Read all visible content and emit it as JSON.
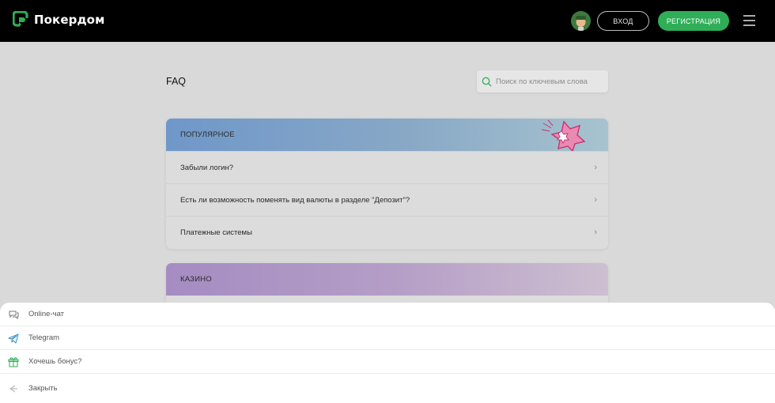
{
  "header": {
    "brand": "Покердом",
    "login_label": "ВХОД",
    "register_label": "РЕГИСТРАЦИЯ",
    "brand_color": "#2fae57"
  },
  "main": {
    "title": "FAQ",
    "search_placeholder": "Поиск по ключевым слова"
  },
  "sections": [
    {
      "title": "ПОПУЛЯРНОЕ",
      "items": [
        "Забыли логин?",
        "Есть ли возможность поменять вид валюты в разделе \"Депозит\"?",
        "Платежные системы"
      ]
    },
    {
      "title": "КАЗИНО",
      "items": []
    }
  ],
  "support_menu": {
    "items": [
      {
        "label": "Online-чат",
        "icon": "chat-icon"
      },
      {
        "label": "Telegram",
        "icon": "telegram-icon"
      },
      {
        "label": "Хочешь бонус?",
        "icon": "gift-icon"
      },
      {
        "label": "Закрыть",
        "icon": "close-icon"
      }
    ]
  }
}
